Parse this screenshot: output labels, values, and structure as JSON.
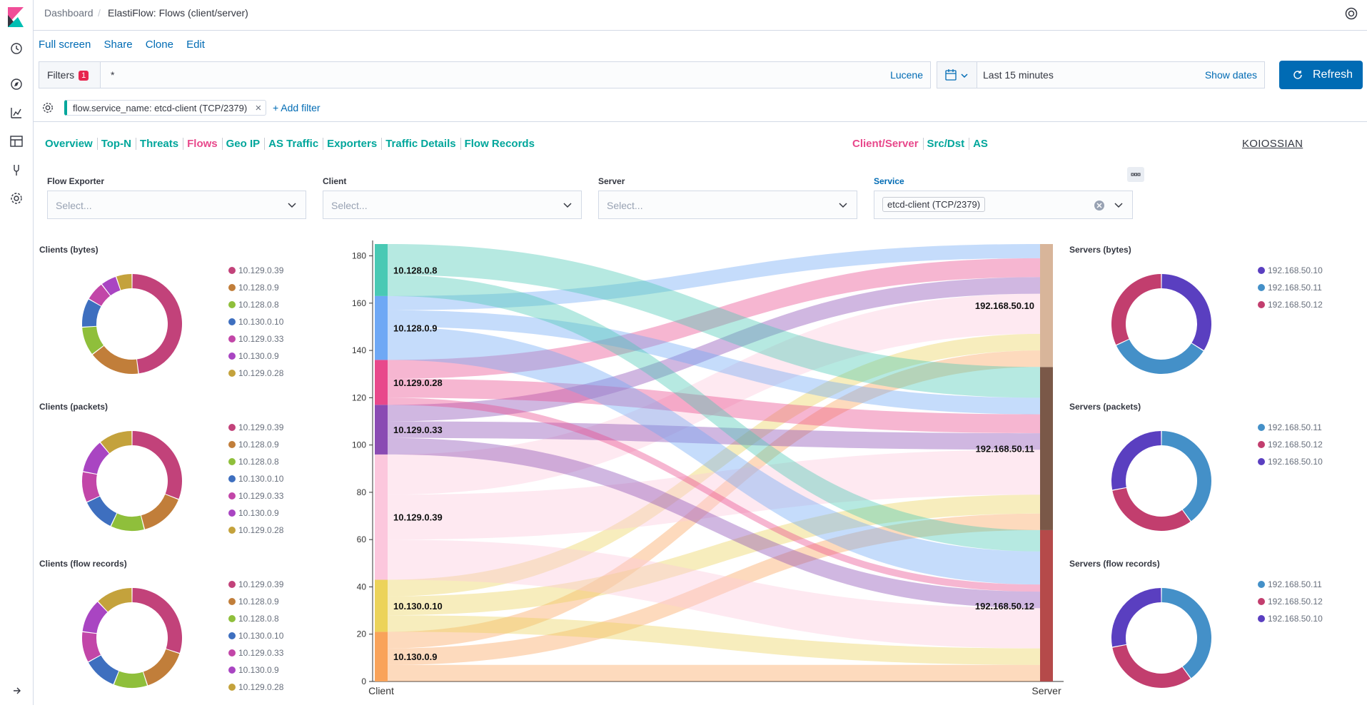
{
  "topbar": {
    "breadcrumb_root": "Dashboard",
    "breadcrumb_page": "ElastiFlow: Flows (client/server)"
  },
  "sidenav": {
    "items": [
      "clock-icon",
      "compass-icon",
      "visualize-icon",
      "dashboard-icon",
      "devtools-icon",
      "gear-icon"
    ]
  },
  "menu": {
    "full_screen": "Full screen",
    "share": "Share",
    "clone": "Clone",
    "edit": "Edit"
  },
  "query": {
    "filters_label": "Filters",
    "filters_count": "1",
    "value": "*",
    "language": "Lucene"
  },
  "time": {
    "range": "Last 15 minutes",
    "show_dates": "Show dates",
    "refresh": "Refresh"
  },
  "filter_pill": {
    "text": "flow.service_name: etcd-client (TCP/2379)",
    "add": "+ Add filter"
  },
  "nav_tabs": [
    {
      "label": "Overview",
      "color": "#00a69b"
    },
    {
      "label": "Top-N",
      "color": "#00a69b"
    },
    {
      "label": "Threats",
      "color": "#00a69b"
    },
    {
      "label": "Flows",
      "color": "#e8488b"
    },
    {
      "label": "Geo IP",
      "color": "#00a69b"
    },
    {
      "label": "AS Traffic",
      "color": "#00a69b"
    },
    {
      "label": "Exporters",
      "color": "#00a69b"
    },
    {
      "label": "Traffic Details",
      "color": "#00a69b"
    },
    {
      "label": "Flow Records",
      "color": "#00a69b"
    }
  ],
  "view_tabs": [
    {
      "label": "Client/Server",
      "color": "#e8488b"
    },
    {
      "label": "Src/Dst",
      "color": "#00a69b"
    },
    {
      "label": "AS",
      "color": "#00a69b"
    }
  ],
  "brand": "KOIOSSIAN",
  "controls": [
    {
      "label": "Flow Exporter",
      "placeholder": "Select..."
    },
    {
      "label": "Client",
      "placeholder": "Select..."
    },
    {
      "label": "Server",
      "placeholder": "Select..."
    },
    {
      "label": "Service",
      "selected": "etcd-client (TCP/2379)"
    }
  ],
  "colors": {
    "10.129.0.39": "#c2427a",
    "10.128.0.9": "#c17e3a",
    "10.128.0.8": "#8fbf3b",
    "10.130.0.10": "#3e6fbf",
    "10.129.0.33": "#c246a8",
    "10.130.0.9": "#a945c2",
    "10.129.0.28": "#c4a23c",
    "192.168.50.10": "#5a3fc0",
    "192.168.50.11": "#4490c8",
    "192.168.50.12": "#c23e6e"
  },
  "chart_data": [
    {
      "type": "pie",
      "title": "Clients (bytes)",
      "donut": true,
      "labels": [
        "10.129.0.39",
        "10.128.0.9",
        "10.128.0.8",
        "10.130.0.10",
        "10.129.0.33",
        "10.130.0.9",
        "10.129.0.28"
      ],
      "values": [
        46,
        16,
        9,
        9,
        6,
        5,
        5
      ]
    },
    {
      "type": "pie",
      "title": "Clients (packets)",
      "donut": true,
      "labels": [
        "10.129.0.39",
        "10.128.0.9",
        "10.128.0.8",
        "10.130.0.10",
        "10.129.0.33",
        "10.130.0.9",
        "10.129.0.28"
      ],
      "values": [
        31,
        15,
        11,
        11,
        10,
        11,
        11
      ]
    },
    {
      "type": "pie",
      "title": "Clients (flow records)",
      "donut": true,
      "labels": [
        "10.129.0.39",
        "10.128.0.9",
        "10.128.0.8",
        "10.130.0.10",
        "10.129.0.33",
        "10.130.0.9",
        "10.129.0.28"
      ],
      "values": [
        30,
        15,
        11,
        11,
        10,
        11,
        12
      ]
    },
    {
      "type": "pie",
      "title": "Servers (bytes)",
      "donut": true,
      "labels": [
        "192.168.50.10",
        "192.168.50.11",
        "192.168.50.12"
      ],
      "values": [
        34,
        34,
        32
      ]
    },
    {
      "type": "pie",
      "title": "Servers (packets)",
      "donut": true,
      "labels": [
        "192.168.50.11",
        "192.168.50.12",
        "192.168.50.10"
      ],
      "values": [
        40,
        32,
        28
      ]
    },
    {
      "type": "pie",
      "title": "Servers (flow records)",
      "donut": true,
      "labels": [
        "192.168.50.11",
        "192.168.50.12",
        "192.168.50.10"
      ],
      "values": [
        40,
        32,
        28
      ]
    },
    {
      "type": "sankey",
      "ylim": [
        0,
        185
      ],
      "yticks": [
        0,
        20,
        40,
        60,
        80,
        100,
        120,
        140,
        160,
        180
      ],
      "xlabels": [
        "Client",
        "Server"
      ],
      "client_nodes": [
        {
          "name": "10.130.0.9",
          "value": 21,
          "color": "#f9a35a"
        },
        {
          "name": "10.130.0.10",
          "value": 22,
          "color": "#ecd35a"
        },
        {
          "name": "10.129.0.39",
          "value": 53,
          "color": "#fcc7dd"
        },
        {
          "name": "10.129.0.33",
          "value": 21,
          "color": "#8a4bb3"
        },
        {
          "name": "10.129.0.28",
          "value": 19,
          "color": "#e8488b"
        },
        {
          "name": "10.128.0.9",
          "value": 27,
          "color": "#6ea8f5"
        },
        {
          "name": "10.128.0.8",
          "value": 22,
          "color": "#49c9b4"
        }
      ],
      "server_nodes": [
        {
          "name": "192.168.50.12",
          "value": 64,
          "color": "#b54a4a"
        },
        {
          "name": "192.168.50.11",
          "value": 69,
          "color": "#7a5848"
        },
        {
          "name": "192.168.50.10",
          "value": 52,
          "color": "#d8b59a"
        }
      ],
      "links": [
        {
          "source": "10.130.0.9",
          "target": "192.168.50.12",
          "value": 7
        },
        {
          "source": "10.130.0.9",
          "target": "192.168.50.11",
          "value": 7
        },
        {
          "source": "10.130.0.9",
          "target": "192.168.50.10",
          "value": 7
        },
        {
          "source": "10.130.0.10",
          "target": "192.168.50.12",
          "value": 7
        },
        {
          "source": "10.130.0.10",
          "target": "192.168.50.11",
          "value": 8
        },
        {
          "source": "10.130.0.10",
          "target": "192.168.50.10",
          "value": 7
        },
        {
          "source": "10.129.0.39",
          "target": "192.168.50.12",
          "value": 17
        },
        {
          "source": "10.129.0.39",
          "target": "192.168.50.11",
          "value": 19
        },
        {
          "source": "10.129.0.39",
          "target": "192.168.50.10",
          "value": 17
        },
        {
          "source": "10.129.0.33",
          "target": "192.168.50.12",
          "value": 7
        },
        {
          "source": "10.129.0.33",
          "target": "192.168.50.11",
          "value": 7
        },
        {
          "source": "10.129.0.33",
          "target": "192.168.50.10",
          "value": 7
        },
        {
          "source": "10.129.0.28",
          "target": "192.168.50.12",
          "value": 3
        },
        {
          "source": "10.129.0.28",
          "target": "192.168.50.11",
          "value": 8
        },
        {
          "source": "10.129.0.28",
          "target": "192.168.50.10",
          "value": 8
        },
        {
          "source": "10.128.0.9",
          "target": "192.168.50.12",
          "value": 14
        },
        {
          "source": "10.128.0.9",
          "target": "192.168.50.11",
          "value": 7
        },
        {
          "source": "10.128.0.9",
          "target": "192.168.50.10",
          "value": 6
        },
        {
          "source": "10.128.0.8",
          "target": "192.168.50.12",
          "value": 9
        },
        {
          "source": "10.128.0.8",
          "target": "192.168.50.11",
          "value": 13
        }
      ]
    }
  ]
}
